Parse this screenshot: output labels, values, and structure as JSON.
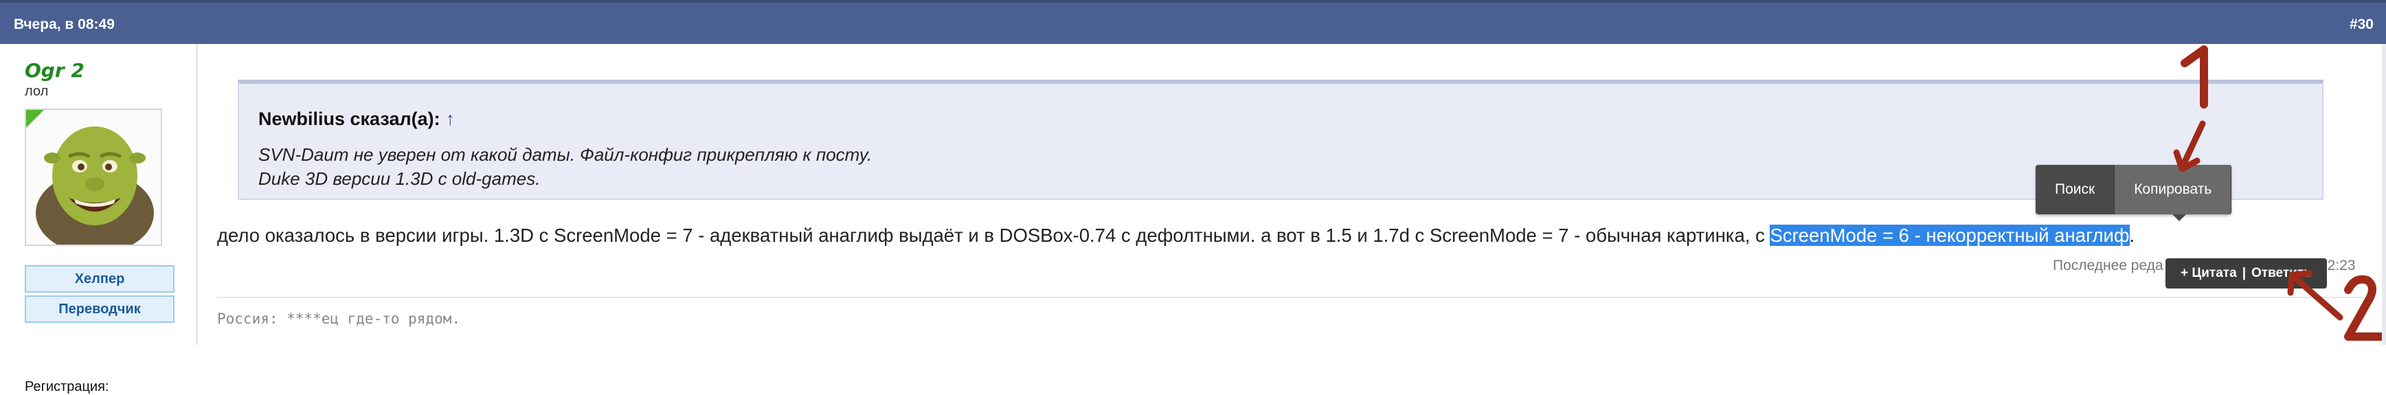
{
  "header": {
    "date": "Вчера, в 08:49",
    "post_number": "#30"
  },
  "user": {
    "name": "Ogr 2",
    "title": "лол",
    "badges": [
      "Хелпер",
      "Переводчик"
    ],
    "registration_label": "Регистрация:"
  },
  "quote": {
    "author": "Newbilius сказал(а):",
    "arrow": "↑",
    "lines": [
      "SVN-Daum не уверен от какой даты. Файл-конфиг прикрепляю к посту.",
      "Duke 3D версии 1.3D с old-games."
    ]
  },
  "post": {
    "text_plain": "дело оказалось в версии игры. 1.3D с ScreenMode = 7 - адекватный анаглиф выдаёт и в DOSBox-0.74 с дефолтными. а вот в 1.5 и 1.7d с ScreenMode = 7 - обычная картинка, с ",
    "text_selected": "ScreenMode = 6 - некорректный анаглиф",
    "text_tail": ".",
    "edited_label": "Последнее реда",
    "edited_time": "22:23",
    "signature": "Россия: ****ец где-то рядом."
  },
  "context_menu": {
    "items": [
      "Поиск",
      "Копировать"
    ]
  },
  "quote_toolbar": {
    "quote_label": "+ Цитата",
    "divider": "|",
    "reply_label": "Ответить"
  },
  "annotations": {
    "one": "1",
    "two": "2",
    "color": "#a02a1a"
  }
}
